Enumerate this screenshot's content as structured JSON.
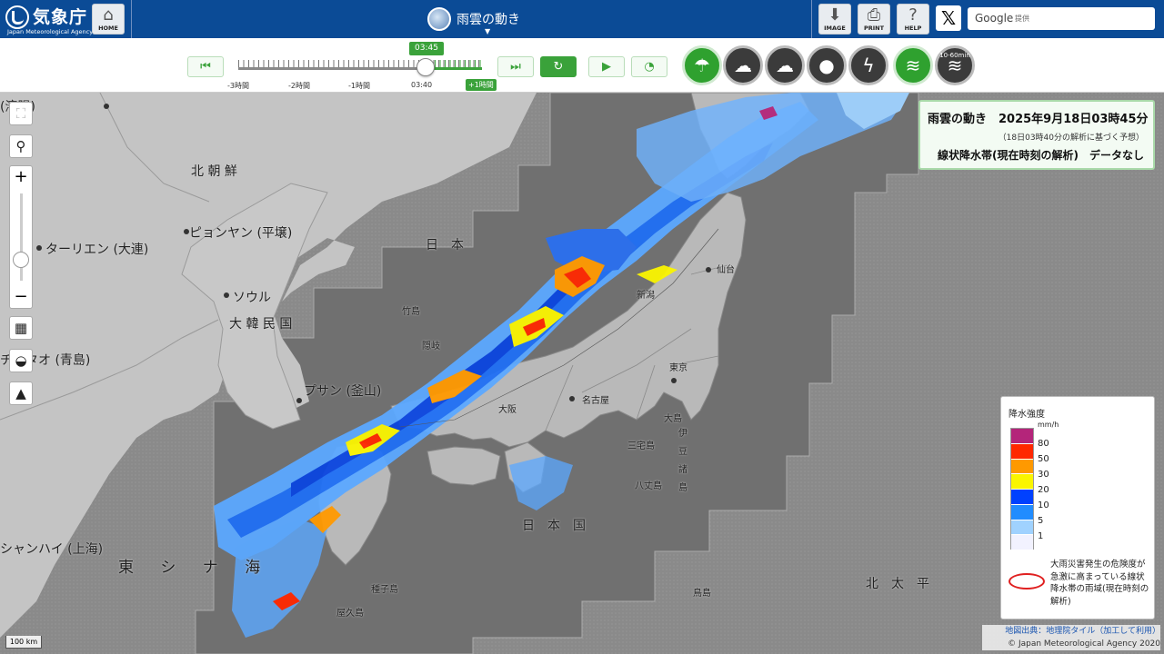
{
  "header": {
    "logo_text": "気象庁",
    "logo_sub": "Japan Meteorological Agency",
    "home_label": "HOME",
    "title": "雨雲の動き",
    "image_label": "IMAGE",
    "print_label": "PRINT",
    "help_label": "HELP",
    "x_label": "𝕏",
    "search_google": "Google",
    "search_provided": "提供"
  },
  "timeline": {
    "current_time": "03:45",
    "labels": [
      "-3時間",
      "-2時間",
      "-1時間",
      "03:40"
    ],
    "future_label": "+1時間",
    "progress_fraction": 0.76
  },
  "layers": [
    {
      "name": "雨雲",
      "active": true,
      "icon": "rain-cloud-icon"
    },
    {
      "name": "雷",
      "active": false,
      "icon": "thunder-cloud-icon"
    },
    {
      "name": "竜巻",
      "active": false,
      "icon": "tornado-cloud-icon"
    },
    {
      "name": "降水量",
      "active": false,
      "icon": "raindrop-icon"
    },
    {
      "name": "雷2",
      "active": false,
      "icon": "lightning-icon"
    },
    {
      "name": "線状降水帯",
      "active": true,
      "icon": "rain-band-icon"
    },
    {
      "name": "10〜60min",
      "active": false,
      "icon": "rain-band-forecast-icon",
      "caption": "10-60min"
    }
  ],
  "info": {
    "title": "雨雲の動き　2025年9月18日03時45分",
    "subtitle": "（18日03時40分の解析に基づく予想）",
    "status": "線状降水帯(現在時刻の解析)　データなし"
  },
  "legend": {
    "title": "降水強度",
    "unit": "mm/h",
    "levels": [
      {
        "value": "80",
        "color": "#b4257a"
      },
      {
        "value": "50",
        "color": "#ff2800"
      },
      {
        "value": "30",
        "color": "#ff9900"
      },
      {
        "value": "20",
        "color": "#faf500"
      },
      {
        "value": "10",
        "color": "#0041ff"
      },
      {
        "value": "5",
        "color": "#218cff"
      },
      {
        "value": "1",
        "color": "#a0d2ff"
      },
      {
        "value": "",
        "color": "#f2f2ff"
      }
    ],
    "band_description": "大雨災害発生の危険度が急激に高まっている線状降水帯の雨域(現在時刻の解析)"
  },
  "map_labels": [
    {
      "text": "北 朝 鮮",
      "cls": ""
    },
    {
      "text": "ピョンヤン (平壌)",
      "cls": ""
    },
    {
      "text": "ターリエン (大連)",
      "cls": ""
    },
    {
      "text": "ソウル",
      "cls": ""
    },
    {
      "text": "大 韓 民 国",
      "cls": ""
    },
    {
      "text": "チンタオ (青島)",
      "cls": ""
    },
    {
      "text": "プサン (釜山)",
      "cls": ""
    },
    {
      "text": "シャンハイ (上海)",
      "cls": ""
    },
    {
      "text": "東 シ ナ 海",
      "cls": "big"
    },
    {
      "text": "日　本",
      "cls": ""
    },
    {
      "text": "日　本　国",
      "cls": ""
    },
    {
      "text": "北　太　平",
      "cls": ""
    },
    {
      "text": "(瀋陽)",
      "cls": ""
    },
    {
      "text": "仙台",
      "cls": "sm"
    },
    {
      "text": "新潟",
      "cls": "sm"
    },
    {
      "text": "東京",
      "cls": "sm"
    },
    {
      "text": "名古屋",
      "cls": "sm"
    },
    {
      "text": "大阪",
      "cls": "sm"
    },
    {
      "text": "竹島",
      "cls": "sm"
    },
    {
      "text": "隠岐",
      "cls": "sm"
    },
    {
      "text": "大島",
      "cls": "sm"
    },
    {
      "text": "三宅島",
      "cls": "sm"
    },
    {
      "text": "伊 豆 諸 島",
      "cls": "sm"
    },
    {
      "text": "八丈島",
      "cls": "sm"
    },
    {
      "text": "種子島",
      "cls": "sm"
    },
    {
      "text": "屋久島",
      "cls": "sm"
    },
    {
      "text": "鳥島",
      "cls": "sm"
    }
  ],
  "scale": "100 km",
  "attribution": {
    "line1": "地図出典：地理院タイル（加工して利用）",
    "line2": "© Japan Meteorological Agency 2020"
  }
}
